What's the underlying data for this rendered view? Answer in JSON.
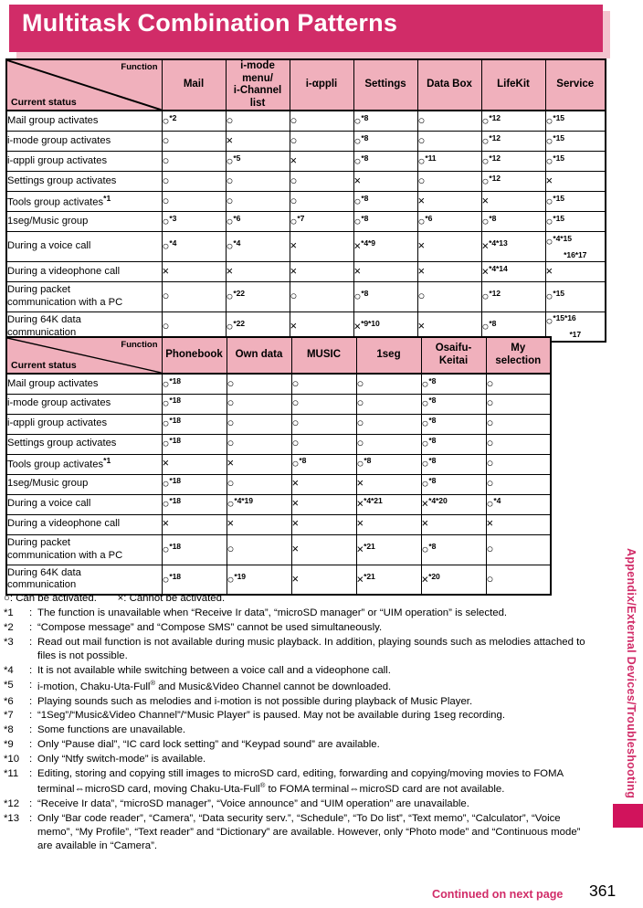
{
  "page": {
    "title": "Multitask Combination Patterns",
    "number": "361",
    "continued": "Continued on next page",
    "side_tab": "Appendix/External Devices/Troubleshooting"
  },
  "table1": {
    "corner": {
      "function_label": "Function",
      "status_label": "Current status"
    },
    "columns": [
      "Mail",
      "i-mode menu/\ni-Channel list",
      "i-αppli",
      "Settings",
      "Data Box",
      "LifeKit",
      "Service"
    ],
    "columns_display": [
      [
        "Mail"
      ],
      [
        "i-mode menu/",
        "i-Channel list"
      ],
      [
        "i-αppli"
      ],
      [
        "Settings"
      ],
      [
        "Data Box"
      ],
      [
        "LifeKit"
      ],
      [
        "Service"
      ]
    ],
    "rows": [
      {
        "label": "Mail group activates",
        "label_sup": "",
        "cells": [
          {
            "mark": "○",
            "sup": "*2"
          },
          {
            "mark": "○",
            "sup": ""
          },
          {
            "mark": "○",
            "sup": ""
          },
          {
            "mark": "○",
            "sup": "*8"
          },
          {
            "mark": "○",
            "sup": ""
          },
          {
            "mark": "○",
            "sup": "*12"
          },
          {
            "mark": "○",
            "sup": "*15"
          }
        ]
      },
      {
        "label": "i-mode group activates",
        "label_sup": "",
        "cells": [
          {
            "mark": "○",
            "sup": ""
          },
          {
            "mark": "×",
            "sup": ""
          },
          {
            "mark": "○",
            "sup": ""
          },
          {
            "mark": "○",
            "sup": "*8"
          },
          {
            "mark": "○",
            "sup": ""
          },
          {
            "mark": "○",
            "sup": "*12"
          },
          {
            "mark": "○",
            "sup": "*15"
          }
        ]
      },
      {
        "label": "i-αppli group activates",
        "label_sup": "",
        "cells": [
          {
            "mark": "○",
            "sup": ""
          },
          {
            "mark": "○",
            "sup": "*5"
          },
          {
            "mark": "×",
            "sup": ""
          },
          {
            "mark": "○",
            "sup": "*8"
          },
          {
            "mark": "○",
            "sup": "*11"
          },
          {
            "mark": "○",
            "sup": "*12"
          },
          {
            "mark": "○",
            "sup": "*15"
          }
        ]
      },
      {
        "label": "Settings group activates",
        "label_sup": "",
        "cells": [
          {
            "mark": "○",
            "sup": ""
          },
          {
            "mark": "○",
            "sup": ""
          },
          {
            "mark": "○",
            "sup": ""
          },
          {
            "mark": "×",
            "sup": ""
          },
          {
            "mark": "○",
            "sup": ""
          },
          {
            "mark": "○",
            "sup": "*12"
          },
          {
            "mark": "×",
            "sup": ""
          }
        ]
      },
      {
        "label": "Tools group activates",
        "label_sup": "*1",
        "cells": [
          {
            "mark": "○",
            "sup": ""
          },
          {
            "mark": "○",
            "sup": ""
          },
          {
            "mark": "○",
            "sup": ""
          },
          {
            "mark": "○",
            "sup": "*8"
          },
          {
            "mark": "×",
            "sup": ""
          },
          {
            "mark": "×",
            "sup": ""
          },
          {
            "mark": "○",
            "sup": "*15"
          }
        ]
      },
      {
        "label": "1seg/Music group",
        "label_sup": "",
        "cells": [
          {
            "mark": "○",
            "sup": "*3"
          },
          {
            "mark": "○",
            "sup": "*6"
          },
          {
            "mark": "○",
            "sup": "*7"
          },
          {
            "mark": "○",
            "sup": "*8"
          },
          {
            "mark": "○",
            "sup": "*6"
          },
          {
            "mark": "○",
            "sup": "*8"
          },
          {
            "mark": "○",
            "sup": "*15"
          }
        ]
      },
      {
        "label": "During a voice call",
        "label_sup": "",
        "tall": true,
        "cells": [
          {
            "mark": "○",
            "sup": "*4"
          },
          {
            "mark": "○",
            "sup": "*4"
          },
          {
            "mark": "×",
            "sup": ""
          },
          {
            "mark": "×",
            "sup": "*4*9"
          },
          {
            "mark": "×",
            "sup": ""
          },
          {
            "mark": "×",
            "sup": "*4*13"
          },
          {
            "mark": "○",
            "sup": "*4*15",
            "sup2": "*16*17"
          }
        ]
      },
      {
        "label": "During a videophone call",
        "label_sup": "",
        "cells": [
          {
            "mark": "×",
            "sup": ""
          },
          {
            "mark": "×",
            "sup": ""
          },
          {
            "mark": "×",
            "sup": ""
          },
          {
            "mark": "×",
            "sup": ""
          },
          {
            "mark": "×",
            "sup": ""
          },
          {
            "mark": "×",
            "sup": "*4*14"
          },
          {
            "mark": "×",
            "sup": ""
          }
        ]
      },
      {
        "label": "During packet\ncommunication with a PC",
        "label_sup": "",
        "twoline": true,
        "cells": [
          {
            "mark": "○",
            "sup": ""
          },
          {
            "mark": "○",
            "sup": "*22"
          },
          {
            "mark": "○",
            "sup": ""
          },
          {
            "mark": "○",
            "sup": "*8"
          },
          {
            "mark": "○",
            "sup": ""
          },
          {
            "mark": "○",
            "sup": "*12"
          },
          {
            "mark": "○",
            "sup": "*15"
          }
        ]
      },
      {
        "label": "During 64K data\ncommunication",
        "label_sup": "",
        "twoline": true,
        "cells": [
          {
            "mark": "○",
            "sup": ""
          },
          {
            "mark": "○",
            "sup": "*22"
          },
          {
            "mark": "×",
            "sup": ""
          },
          {
            "mark": "×",
            "sup": "*9*10"
          },
          {
            "mark": "×",
            "sup": ""
          },
          {
            "mark": "○",
            "sup": "*8"
          },
          {
            "mark": "○",
            "sup": "*15*16",
            "sup2": "*17"
          }
        ]
      }
    ]
  },
  "table2": {
    "corner": {
      "function_label": "Function",
      "status_label": "Current status"
    },
    "columns_display": [
      [
        "Phonebook"
      ],
      [
        "Own data"
      ],
      [
        "MUSIC"
      ],
      [
        "1seg"
      ],
      [
        "Osaifu-",
        "Keitai"
      ],
      [
        "My",
        "selection"
      ]
    ],
    "rows": [
      {
        "label": "Mail group activates",
        "label_sup": "",
        "cells": [
          {
            "mark": "○",
            "sup": "*18"
          },
          {
            "mark": "○",
            "sup": ""
          },
          {
            "mark": "○",
            "sup": ""
          },
          {
            "mark": "○",
            "sup": ""
          },
          {
            "mark": "○",
            "sup": "*8"
          },
          {
            "mark": "○",
            "sup": ""
          }
        ]
      },
      {
        "label": "i-mode group activates",
        "label_sup": "",
        "cells": [
          {
            "mark": "○",
            "sup": "*18"
          },
          {
            "mark": "○",
            "sup": ""
          },
          {
            "mark": "○",
            "sup": ""
          },
          {
            "mark": "○",
            "sup": ""
          },
          {
            "mark": "○",
            "sup": "*8"
          },
          {
            "mark": "○",
            "sup": ""
          }
        ]
      },
      {
        "label": "i-αppli group activates",
        "label_sup": "",
        "cells": [
          {
            "mark": "○",
            "sup": "*18"
          },
          {
            "mark": "○",
            "sup": ""
          },
          {
            "mark": "○",
            "sup": ""
          },
          {
            "mark": "○",
            "sup": ""
          },
          {
            "mark": "○",
            "sup": "*8"
          },
          {
            "mark": "○",
            "sup": ""
          }
        ]
      },
      {
        "label": "Settings group activates",
        "label_sup": "",
        "cells": [
          {
            "mark": "○",
            "sup": "*18"
          },
          {
            "mark": "○",
            "sup": ""
          },
          {
            "mark": "○",
            "sup": ""
          },
          {
            "mark": "○",
            "sup": ""
          },
          {
            "mark": "○",
            "sup": "*8"
          },
          {
            "mark": "○",
            "sup": ""
          }
        ]
      },
      {
        "label": "Tools group activates",
        "label_sup": "*1",
        "cells": [
          {
            "mark": "×",
            "sup": ""
          },
          {
            "mark": "×",
            "sup": ""
          },
          {
            "mark": "○",
            "sup": "*8"
          },
          {
            "mark": "○",
            "sup": "*8"
          },
          {
            "mark": "○",
            "sup": "*8"
          },
          {
            "mark": "○",
            "sup": ""
          }
        ]
      },
      {
        "label": "1seg/Music group",
        "label_sup": "",
        "cells": [
          {
            "mark": "○",
            "sup": "*18"
          },
          {
            "mark": "○",
            "sup": ""
          },
          {
            "mark": "×",
            "sup": ""
          },
          {
            "mark": "×",
            "sup": ""
          },
          {
            "mark": "○",
            "sup": "*8"
          },
          {
            "mark": "○",
            "sup": ""
          }
        ]
      },
      {
        "label": "During a voice call",
        "label_sup": "",
        "cells": [
          {
            "mark": "○",
            "sup": "*18"
          },
          {
            "mark": "○",
            "sup": "*4*19"
          },
          {
            "mark": "×",
            "sup": ""
          },
          {
            "mark": "×",
            "sup": "*4*21"
          },
          {
            "mark": "×",
            "sup": "*4*20"
          },
          {
            "mark": "○",
            "sup": "*4"
          }
        ]
      },
      {
        "label": "During a videophone call",
        "label_sup": "",
        "cells": [
          {
            "mark": "×",
            "sup": ""
          },
          {
            "mark": "×",
            "sup": ""
          },
          {
            "mark": "×",
            "sup": ""
          },
          {
            "mark": "×",
            "sup": ""
          },
          {
            "mark": "×",
            "sup": ""
          },
          {
            "mark": "×",
            "sup": ""
          }
        ]
      },
      {
        "label": "During packet\ncommunication with a PC",
        "label_sup": "",
        "twoline": true,
        "cells": [
          {
            "mark": "○",
            "sup": "*18"
          },
          {
            "mark": "○",
            "sup": ""
          },
          {
            "mark": "×",
            "sup": ""
          },
          {
            "mark": "×",
            "sup": "*21"
          },
          {
            "mark": "○",
            "sup": "*8"
          },
          {
            "mark": "○",
            "sup": ""
          }
        ]
      },
      {
        "label": "During 64K data\ncommunication",
        "label_sup": "",
        "twoline": true,
        "cells": [
          {
            "mark": "○",
            "sup": "*18"
          },
          {
            "mark": "○",
            "sup": "*19"
          },
          {
            "mark": "×",
            "sup": ""
          },
          {
            "mark": "×",
            "sup": "*21"
          },
          {
            "mark": "×",
            "sup": "*20"
          },
          {
            "mark": "○",
            "sup": ""
          }
        ]
      }
    ]
  },
  "legend": "○: Can be activated.  ×: Cannot be activated.",
  "notes": [
    {
      "num": "*1",
      "text": "The function is unavailable when “Receive Ir data”, “microSD manager” or “UIM operation” is selected."
    },
    {
      "num": "*2",
      "text": "“Compose message” and “Compose SMS” cannot be used simultaneously."
    },
    {
      "num": "*3",
      "text": "Read out mail function is not available during music playback. In addition, playing sounds such as melodies attached to files is not possible."
    },
    {
      "num": "*4",
      "text": "It is not available while switching between a voice call and a videophone call."
    },
    {
      "num": "*5",
      "text": "i-motion, Chaku-Uta-Full® and Music&Video Channel cannot be downloaded."
    },
    {
      "num": "*6",
      "text": "Playing sounds such as melodies and i-motion is not possible during playback of Music Player."
    },
    {
      "num": "*7",
      "text": "“1Seg”/“Music&Video Channel”/“Music Player” is paused. May not be available during 1seg recording."
    },
    {
      "num": "*8",
      "text": "Some functions are unavailable."
    },
    {
      "num": "*9",
      "text": "Only “Pause dial”, “IC card lock setting” and “Keypad sound” are available."
    },
    {
      "num": "*10",
      "text": "Only “Ntfy switch-mode” is available."
    },
    {
      "num": "*11",
      "text": "Editing, storing and copying still images to microSD card, editing, forwarding and copying/moving movies to FOMA terminal⇔microSD card, moving Chaku-Uta-Full® to FOMA terminal⇔microSD card are not available."
    },
    {
      "num": "*12",
      "text": "“Receive Ir data”, “microSD manager”, “Voice announce” and “UIM operation” are unavailable."
    },
    {
      "num": "*13",
      "text": "Only “Bar code reader”, “Camera”, “Data security serv.”, “Schedule”, “To Do list”, “Text memo”, “Calculator”, “Voice memo”, “My Profile”, “Text reader” and “Dictionary” are available. However, only “Photo mode” and “Continuous mode” are available in “Camera”."
    }
  ],
  "colors": {
    "brand_pink": "#d12c68",
    "header_pink": "#f0b0bc",
    "shadow_pink": "#f3c3ce",
    "tab_pink": "#d1135c"
  }
}
